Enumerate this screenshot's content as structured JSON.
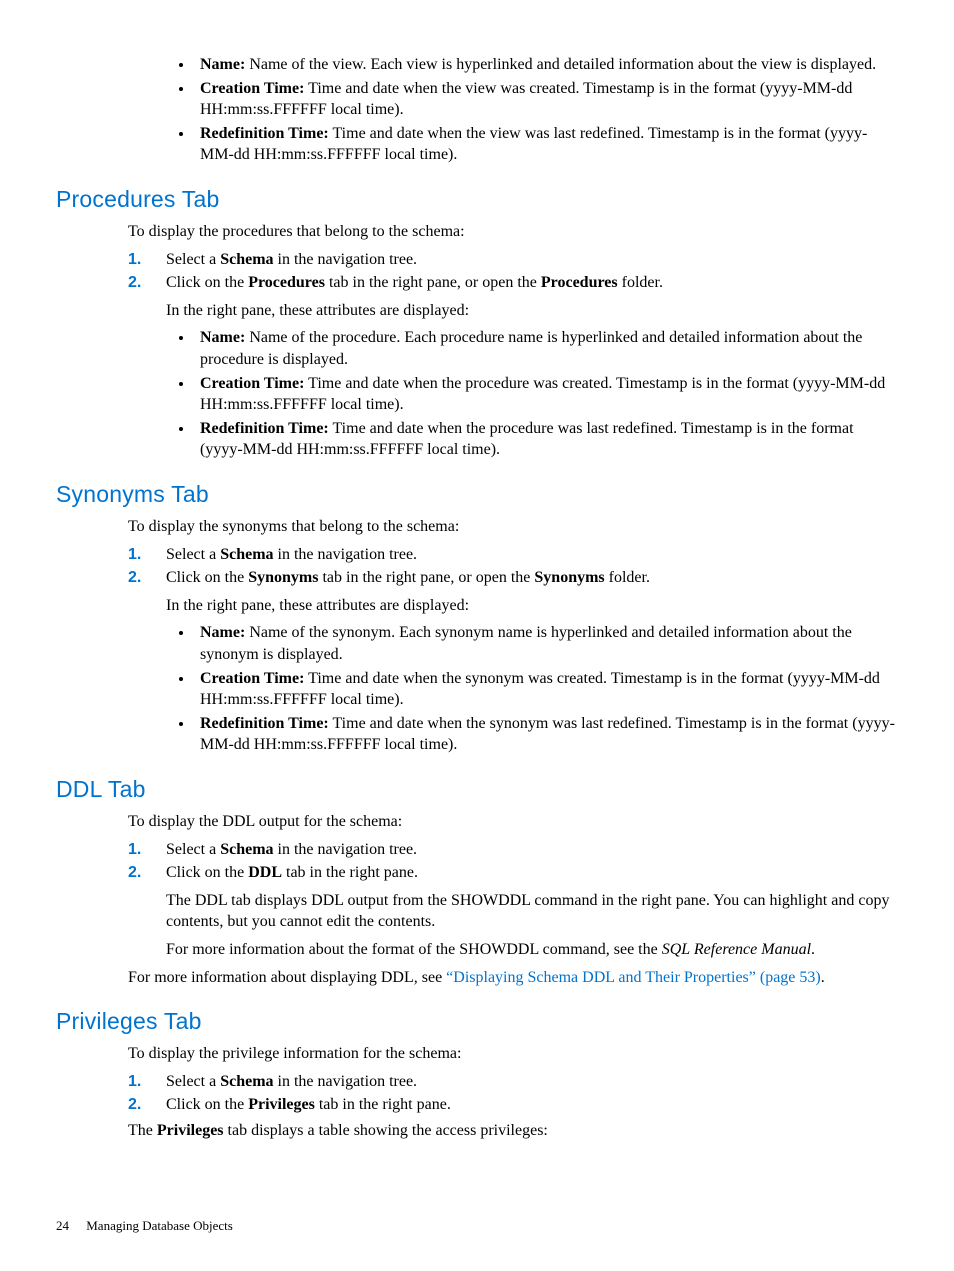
{
  "topBullets": [
    {
      "label": "Name:",
      "text": " Name of the view. Each view is hyperlinked and detailed information about the view is displayed."
    },
    {
      "label": "Creation Time:",
      "text": " Time and date when the view was created. Timestamp is in the format (yyyy-MM-dd HH:mm:ss.FFFFFF local time)."
    },
    {
      "label": "Redefinition Time:",
      "text": " Time and date when the view was last redefined. Timestamp is in the format (yyyy-MM-dd HH:mm:ss.FFFFFF local time)."
    }
  ],
  "procedures": {
    "heading": "Procedures Tab",
    "intro": "To display the procedures that belong to the schema:",
    "step1_a": "Select a ",
    "step1_b": "Schema",
    "step1_c": " in the navigation tree.",
    "step2_a": "Click on the ",
    "step2_b": "Procedures",
    "step2_c": " tab in the right pane, or open the ",
    "step2_d": "Procedures",
    "step2_e": " folder.",
    "attrIntro": "In the right pane, these attributes are displayed:",
    "bullets": [
      {
        "label": "Name:",
        "text": " Name of the procedure. Each procedure name is hyperlinked and detailed information about the procedure is displayed."
      },
      {
        "label": "Creation Time:",
        "text": " Time and date when the procedure was created. Timestamp is in the format (yyyy-MM-dd HH:mm:ss.FFFFFF local time)."
      },
      {
        "label": "Redefinition Time:",
        "text": " Time and date when the procedure was last redefined. Timestamp is in the format (yyyy-MM-dd HH:mm:ss.FFFFFF local time)."
      }
    ]
  },
  "synonyms": {
    "heading": "Synonyms Tab",
    "intro": "To display the synonyms that belong to the schema:",
    "step1_a": "Select a ",
    "step1_b": "Schema",
    "step1_c": " in the navigation tree.",
    "step2_a": "Click on the ",
    "step2_b": "Synonyms",
    "step2_c": " tab in the right pane, or open the ",
    "step2_d": "Synonyms",
    "step2_e": " folder.",
    "attrIntro": "In the right pane, these attributes are displayed:",
    "bullets": [
      {
        "label": "Name:",
        "text": " Name of the synonym. Each synonym name is hyperlinked and detailed information about the synonym is displayed."
      },
      {
        "label": "Creation Time:",
        "text": " Time and date when the synonym was created. Timestamp is in the format (yyyy-MM-dd HH:mm:ss.FFFFFF local time)."
      },
      {
        "label": "Redefinition Time:",
        "text": " Time and date when the synonym was last redefined. Timestamp is in the format (yyyy-MM-dd HH:mm:ss.FFFFFF local time)."
      }
    ]
  },
  "ddl": {
    "heading": "DDL Tab",
    "intro": "To display the DDL output for the schema:",
    "step1_a": "Select a ",
    "step1_b": "Schema",
    "step1_c": " in the navigation tree.",
    "step2_a": "Click on the ",
    "step2_b": "DDL",
    "step2_c": " tab in the right pane.",
    "p1": "The DDL tab displays DDL output from the SHOWDDL command in the right pane. You can highlight and copy contents, but you cannot edit the contents.",
    "p2_a": "For more information about the format of the SHOWDDL command, see the ",
    "p2_em": "SQL Reference Manual",
    "p2_b": ".",
    "more_a": "For more information about displaying DDL, see ",
    "more_link": "“Displaying Schema DDL and Their Properties” (page 53)",
    "more_b": "."
  },
  "privileges": {
    "heading": "Privileges Tab",
    "intro": "To display the privilege information for the schema:",
    "step1_a": "Select a ",
    "step1_b": "Schema",
    "step1_c": " in the navigation tree.",
    "step2_a": "Click on the ",
    "step2_b": "Privileges",
    "step2_c": " tab in the right pane.",
    "p_a": "The ",
    "p_b": "Privileges",
    "p_c": " tab displays a table showing the access privileges:"
  },
  "footer": {
    "pageNum": "24",
    "chapter": "Managing Database Objects"
  }
}
